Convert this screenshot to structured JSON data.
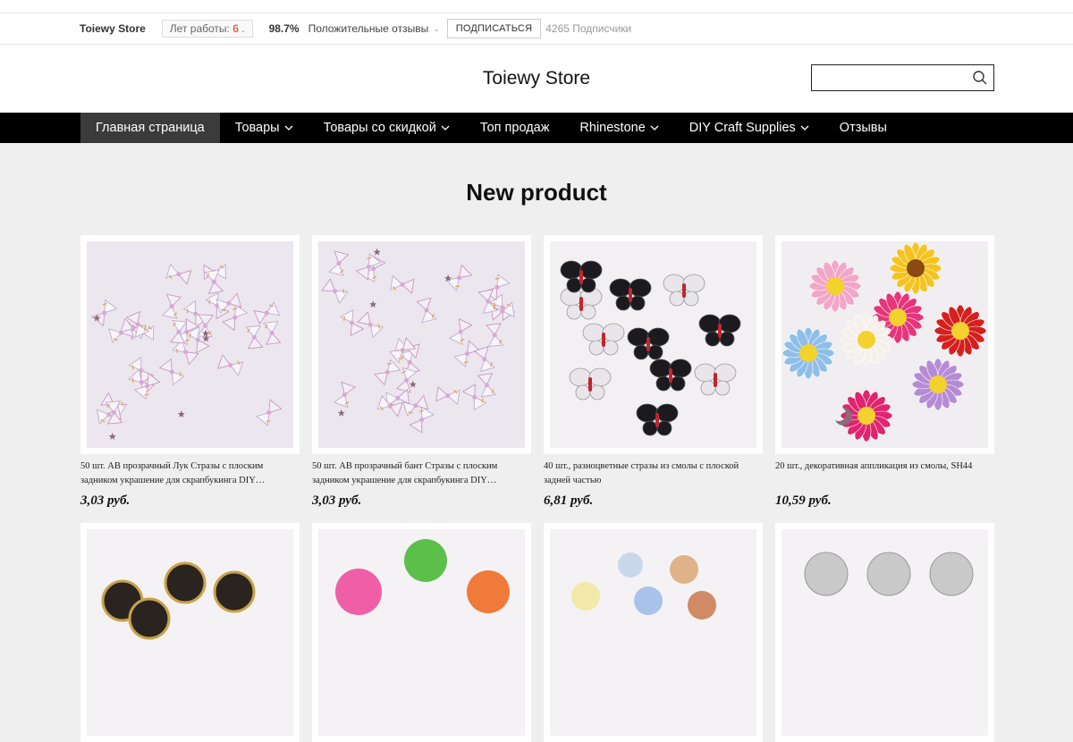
{
  "infobar": {
    "store_name": "Toiewy Store",
    "years_label": "Лет работы:",
    "years_value": "6 .",
    "positive_pct": "98.7%",
    "positive_label": "Положительные отзывы",
    "subscribe_label": "ПОДПИСАТЬСЯ",
    "subscribers": "4265 Подписчики"
  },
  "header": {
    "store_title": "Toiewy Store",
    "search_placeholder": ""
  },
  "nav": {
    "items": [
      {
        "label": "Главная страница",
        "dropdown": false,
        "active": true
      },
      {
        "label": "Товары",
        "dropdown": true,
        "active": false
      },
      {
        "label": "Товары со скидкой",
        "dropdown": true,
        "active": false
      },
      {
        "label": "Топ продаж",
        "dropdown": false,
        "active": false
      },
      {
        "label": "Rhinestone",
        "dropdown": true,
        "active": false
      },
      {
        "label": "DIY Craft Supplies",
        "dropdown": true,
        "active": false
      },
      {
        "label": "Отзывы",
        "dropdown": false,
        "active": false
      }
    ]
  },
  "section": {
    "title": "New product"
  },
  "products": [
    {
      "title": "50 шт. AB прозрачный Лук Стразы с плоским задником украшение для скрапбукинга DIY…",
      "price": "3,03 руб."
    },
    {
      "title": "50 шт. AB прозрачный бант Стразы с плоским задником украшение для скрапбукинга DIY…",
      "price": "3,03 руб."
    },
    {
      "title": "40 шт., разноцветные стразы из смолы с плоской задней частью",
      "price": "6,81 руб."
    },
    {
      "title": "20 шт., декоративная аппликация из смолы, SH44",
      "price": "10,59 руб."
    },
    {
      "title": "",
      "price": ""
    },
    {
      "title": "",
      "price": ""
    },
    {
      "title": "",
      "price": ""
    },
    {
      "title": "",
      "price": ""
    }
  ],
  "colors": {
    "nav_bg": "#000000",
    "nav_active_bg": "#3b3b3b",
    "years_accent": "#e62e04",
    "page_bg": "#efefef"
  }
}
